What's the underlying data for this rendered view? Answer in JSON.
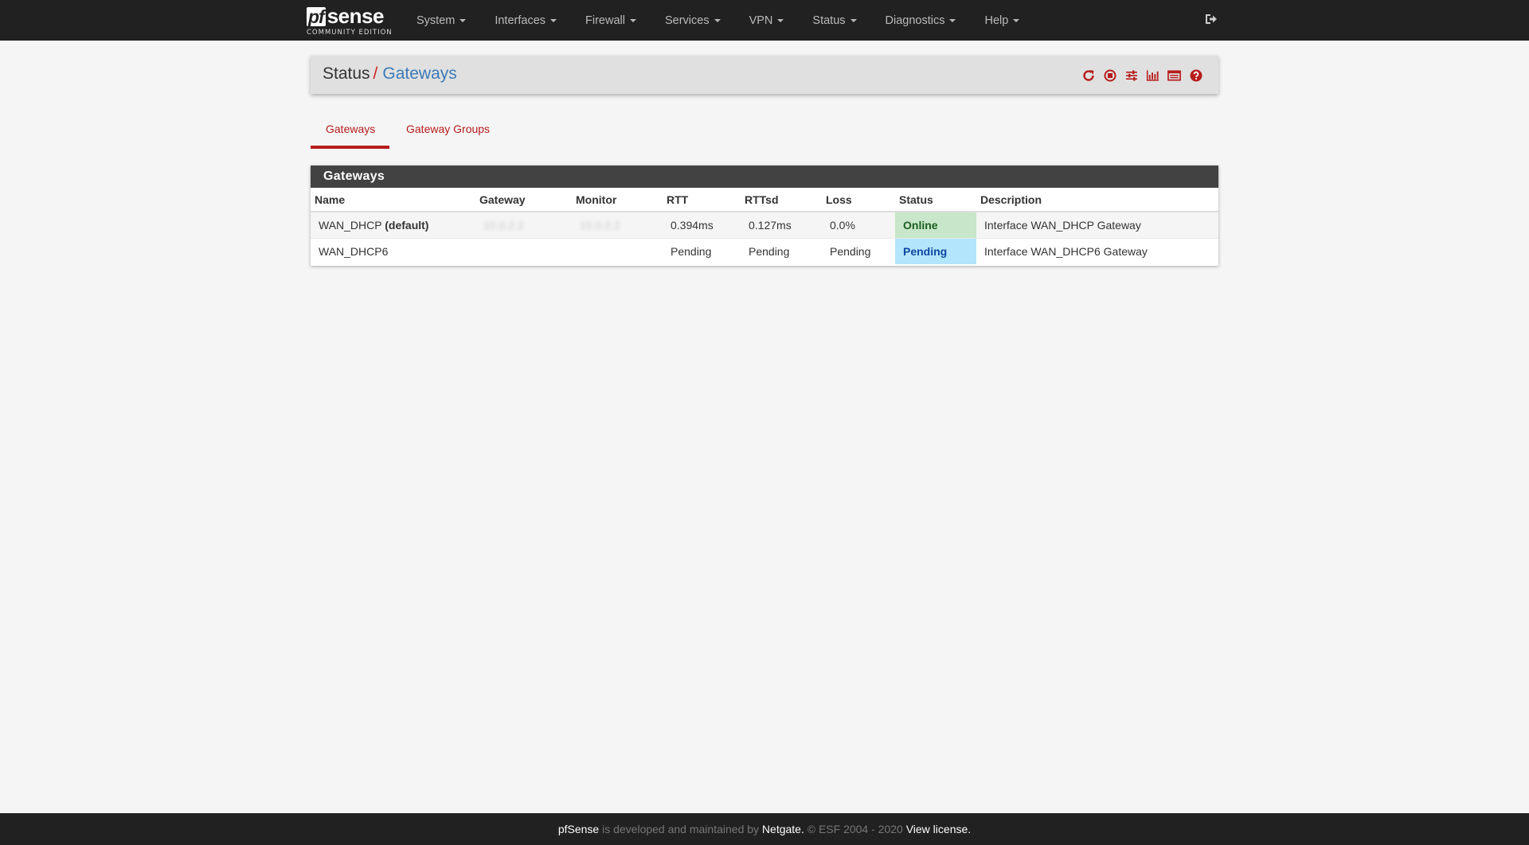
{
  "brand": {
    "logo_prefix": "pf",
    "logo_suffix": "sense",
    "edition": "COMMUNITY EDITION"
  },
  "nav": {
    "menu": [
      {
        "label": "System"
      },
      {
        "label": "Interfaces"
      },
      {
        "label": "Firewall"
      },
      {
        "label": "Services"
      },
      {
        "label": "VPN"
      },
      {
        "label": "Status"
      },
      {
        "label": "Diagnostics"
      },
      {
        "label": "Help"
      }
    ],
    "logout_icon": "sign-out-icon"
  },
  "breadcrumb": {
    "section": "Status",
    "separator": "/",
    "current": "Gateways"
  },
  "toolbar": {
    "icons": [
      "refresh-icon",
      "stop-circle-icon",
      "sliders-icon",
      "bar-chart-icon",
      "log-list-icon",
      "help-circle-icon"
    ],
    "color": "#b71c1c"
  },
  "tabs": [
    {
      "label": "Gateways",
      "active": true
    },
    {
      "label": "Gateway Groups",
      "active": false
    }
  ],
  "panel": {
    "title": "Gateways",
    "columns": [
      "Name",
      "Gateway",
      "Monitor",
      "RTT",
      "RTTsd",
      "Loss",
      "Status",
      "Description"
    ],
    "rows": [
      {
        "name": "WAN_DHCP",
        "name_suffix": "(default)",
        "gateway": "10.0.2.2",
        "monitor": "10.0.2.2",
        "rtt": "0.394ms",
        "rttsd": "0.127ms",
        "loss": "0.0%",
        "status": "Online",
        "description": "Interface WAN_DHCP Gateway"
      },
      {
        "name": "WAN_DHCP6",
        "name_suffix": "",
        "gateway": "",
        "monitor": "",
        "rtt": "Pending",
        "rttsd": "Pending",
        "loss": "Pending",
        "status": "Pending",
        "description": "Interface WAN_DHCP6 Gateway"
      }
    ],
    "status_colors": {
      "online": "#c8e6c9",
      "pending": "#b3e5fc"
    }
  },
  "footer": {
    "brand": "pfSense",
    "text1": " is developed and maintained by ",
    "company": "Netgate.",
    "text2": " © ESF 2004 - 2020 ",
    "license": "View license."
  }
}
